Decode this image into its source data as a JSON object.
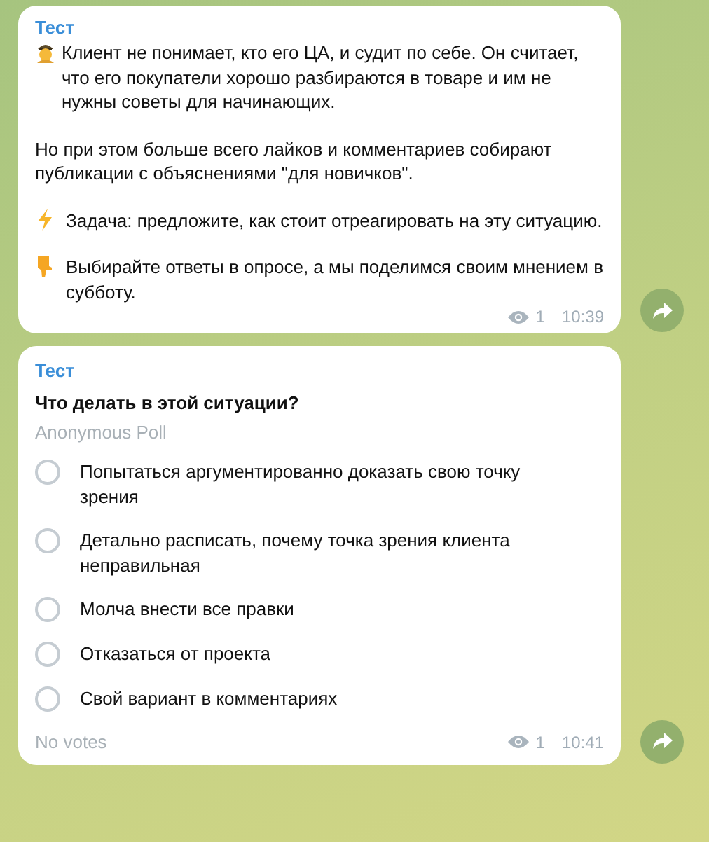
{
  "messages": [
    {
      "kind": "text",
      "author": "Тест",
      "paragraphs": [
        {
          "kind": "officer",
          "text": "Клиент не понимает, кто его ЦА, и судит по себе. Он считает, что его покупатели хорошо разбираются в товаре и им не нужны советы для начинающих."
        },
        {
          "kind": "plain",
          "text": "Но при этом больше всего лайков и комментариев собирают публикации с объяснениями \"для новичков\"."
        },
        {
          "kind": "lightning",
          "text": "Задача: предложите, как стоит отреагировать на эту ситуацию."
        },
        {
          "kind": "hand",
          "text": "Выбирайте ответы в опросе, а мы поделимся своим мнением в субботу."
        }
      ],
      "views": "1",
      "time": "10:39"
    },
    {
      "kind": "poll",
      "author": "Тест",
      "question": "Что делать в этой ситуации?",
      "poll_type": "Anonymous Poll",
      "options": [
        {
          "text": "Попытаться аргументированно доказать свою точку зрения",
          "selected": false
        },
        {
          "text": "Детально расписать, почему точка зрения клиента неправильная",
          "selected": false
        },
        {
          "text": "Молча внести все правки",
          "selected": false
        },
        {
          "text": "Отказаться от проекта",
          "selected": false
        },
        {
          "text": "Свой вариант в комментариях",
          "selected": false
        }
      ],
      "votes": "No votes",
      "views": "1",
      "time": "10:41"
    }
  ]
}
